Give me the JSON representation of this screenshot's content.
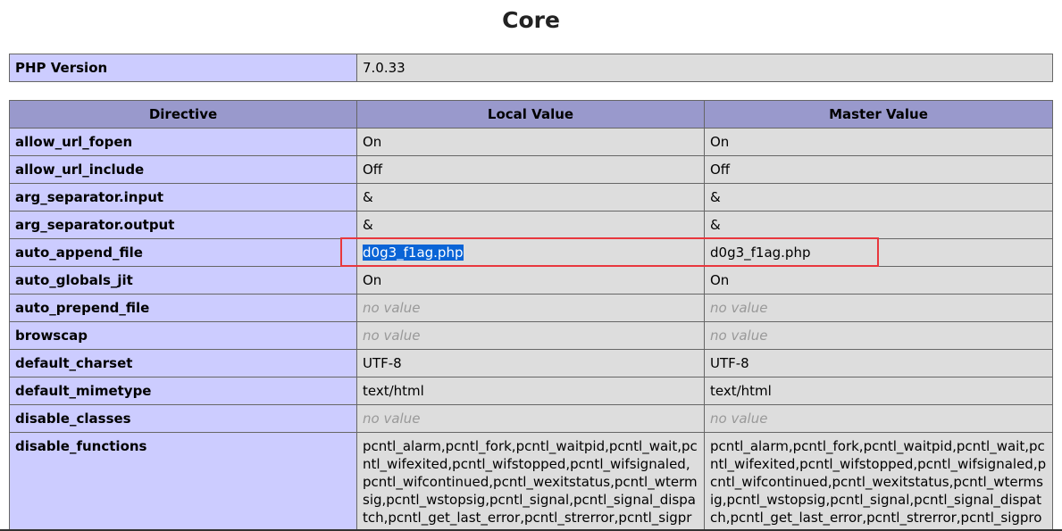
{
  "section": {
    "title": "Core"
  },
  "version_table": {
    "label": "PHP Version",
    "value": "7.0.33"
  },
  "directive_table": {
    "headers": [
      "Directive",
      "Local Value",
      "Master Value"
    ],
    "rows": [
      {
        "directive": "allow_url_fopen",
        "local": "On",
        "master": "On"
      },
      {
        "directive": "allow_url_include",
        "local": "Off",
        "master": "Off"
      },
      {
        "directive": "arg_separator.input",
        "local": "&",
        "master": "&"
      },
      {
        "directive": "arg_separator.output",
        "local": "&",
        "master": "&"
      },
      {
        "directive": "auto_append_file",
        "local": "d0g3_f1ag.php",
        "master": "d0g3_f1ag.php"
      },
      {
        "directive": "auto_globals_jit",
        "local": "On",
        "master": "On"
      },
      {
        "directive": "auto_prepend_file",
        "local": "no value",
        "master": "no value"
      },
      {
        "directive": "browscap",
        "local": "no value",
        "master": "no value"
      },
      {
        "directive": "default_charset",
        "local": "UTF-8",
        "master": "UTF-8"
      },
      {
        "directive": "default_mimetype",
        "local": "text/html",
        "master": "text/html"
      },
      {
        "directive": "disable_classes",
        "local": "no value",
        "master": "no value"
      },
      {
        "directive": "disable_functions",
        "local": "pcntl_alarm,pcntl_fork,pcntl_waitpid,pcntl_wait,pcntl_wifexited,pcntl_wifstopped,pcntl_wifsignaled,pcntl_wifcontinued,pcntl_wexitstatus,pcntl_wtermsig,pcntl_wstopsig,pcntl_signal,pcntl_signal_dispatch,pcntl_get_last_error,pcntl_strerror,pcntl_sigprocmask,pcntl_s",
        "master": "pcntl_alarm,pcntl_fork,pcntl_waitpid,pcntl_wait,pcntl_wifexited,pcntl_wifstopped,pcntl_wifsignaled,pcntl_wifcontinued,pcntl_wexitstatus,pcntl_wtermsig,pcntl_wstopsig,pcntl_signal,pcntl_signal_dispatch,pcntl_get_last_error,pcntl_strerror,pcntl_sigprocmask,pcntl_s"
      }
    ]
  },
  "colors": {
    "header_bg": "#9999cc",
    "directive_bg": "#ccccff",
    "value_bg": "#dddddd",
    "highlight_border": "#e8373d",
    "selection_bg": "#0a64d6"
  }
}
